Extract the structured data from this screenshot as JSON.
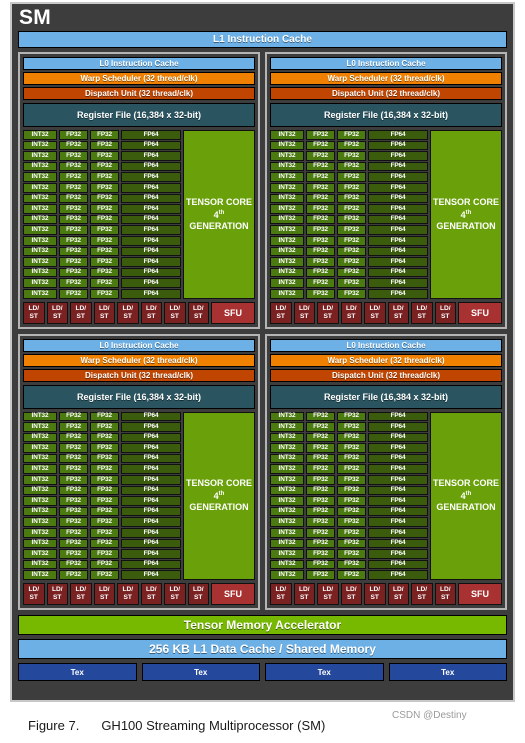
{
  "sm": {
    "title": "SM",
    "l1_instruction_cache": "L1 Instruction Cache",
    "tensor_memory_accelerator": "Tensor Memory Accelerator",
    "l1_data_cache": "256 KB L1 Data Cache / Shared Memory",
    "tex_label": "Tex",
    "tex_count": 4
  },
  "processing_block": {
    "l0_instruction_cache": "L0 Instruction Cache",
    "warp_scheduler": "Warp Scheduler (32 thread/clk)",
    "dispatch_unit": "Dispatch Unit (32 thread/clk)",
    "register_file": "Register File (16,384 x 32-bit)",
    "core_rows": 16,
    "int32_label": "INT32",
    "fp32_label": "FP32",
    "fp64_label": "FP64",
    "tensor_core_line1": "TENSOR CORE",
    "tensor_core_line2_prefix": "4",
    "tensor_core_line2_sup": "th",
    "tensor_core_line2_suffix": " GENERATION",
    "ldst_label_line1": "LD/",
    "ldst_label_line2": "ST",
    "ldst_count": 8,
    "sfu_label": "SFU"
  },
  "block_count": 4,
  "caption": {
    "figure_number": "Figure 7.",
    "figure_title": "GH100 Streaming Multiprocessor (SM)"
  },
  "watermark": "CSDN @Destiny",
  "colors": {
    "sm_background": "#3d3d3d",
    "instruction_cache": "#6cb0e6",
    "warp_scheduler": "#f08000",
    "dispatch_unit": "#bf4500",
    "register_file": "#2a5560",
    "int32_fp32_core": "#4a7a10",
    "fp64_core": "#3a5c0c",
    "tensor_core": "#6aa00a",
    "ldst": "#7a2222",
    "sfu": "#a83232",
    "tensor_memory_accelerator": "#76b900",
    "tex": "#24499c"
  }
}
